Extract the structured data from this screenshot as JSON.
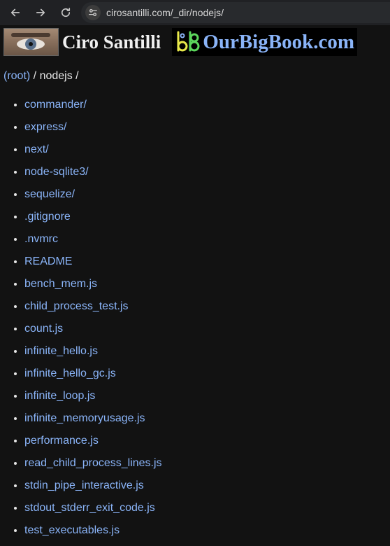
{
  "browser": {
    "url": "cirosantilli.com/_dir/nodejs/"
  },
  "banner": {
    "name": "Ciro Santilli",
    "site_name": "OurBigBook.com"
  },
  "breadcrumb": {
    "root_label": "(root)",
    "path_text": " / nodejs /"
  },
  "entries": [
    "commander/",
    "express/",
    "next/",
    "node-sqlite3/",
    "sequelize/",
    ".gitignore",
    ".nvmrc",
    "README",
    "bench_mem.js",
    "child_process_test.js",
    "count.js",
    "infinite_hello.js",
    "infinite_hello_gc.js",
    "infinite_loop.js",
    "infinite_memoryusage.js",
    "performance.js",
    "read_child_process_lines.js",
    "stdin_pipe_interactive.js",
    "stdout_stderr_exit_code.js",
    "test_executables.js"
  ]
}
